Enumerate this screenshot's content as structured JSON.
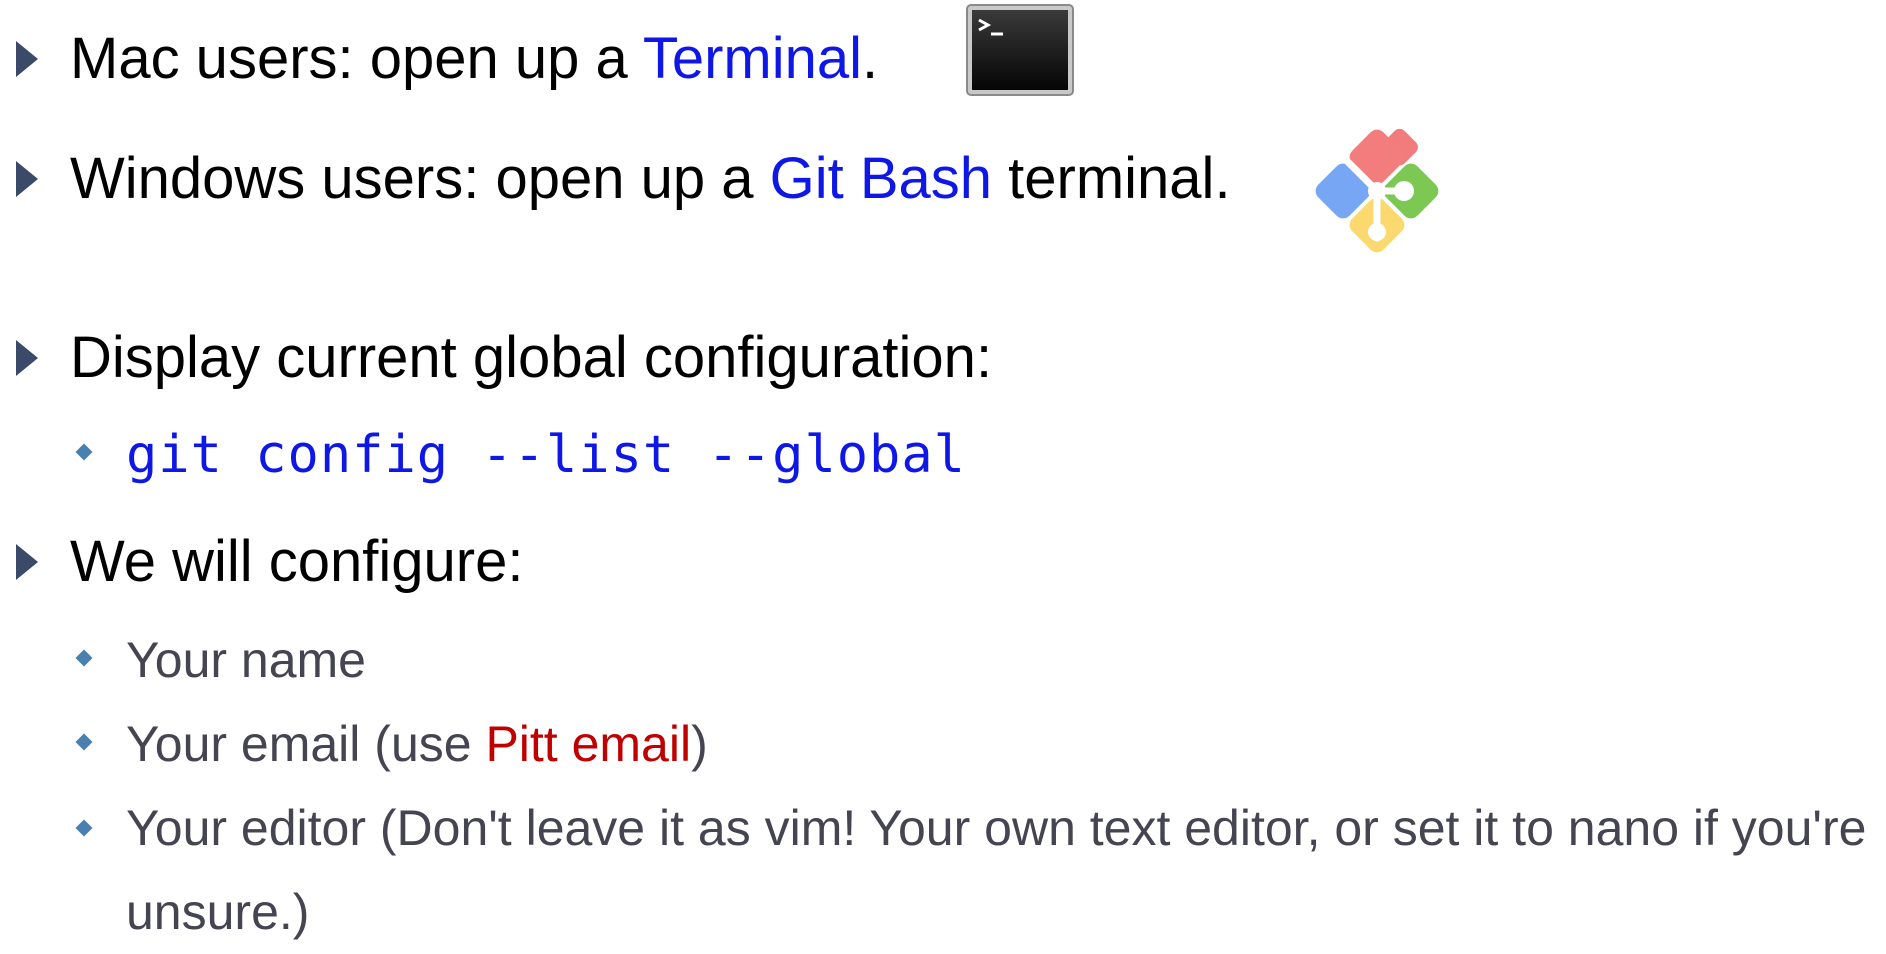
{
  "slide": {
    "b1": {
      "text": "Mac users: open up a ",
      "link": "Terminal",
      "end": "."
    },
    "b2": {
      "text": "Windows users: open up a ",
      "link": "Git Bash",
      "end": " terminal."
    },
    "b3": {
      "text": "Display current global configuration:"
    },
    "b3_sub": {
      "code": "git config --list --global"
    },
    "b4": {
      "text": "We will configure:"
    },
    "b4_sub": [
      {
        "text": "Your name"
      },
      {
        "text": "Your email (use ",
        "highlight": "Pitt email",
        "end": ")"
      },
      {
        "text": "Your editor (Don't leave it as vim! Your own text editor, or set it to nano if you're unsure.)"
      }
    ]
  },
  "icons": {
    "terminal": "terminal-icon",
    "git": "git-bash-icon"
  },
  "colors": {
    "link": "#0f17e6",
    "highlight": "#c00000",
    "bullet_arrow": "#3b4a68",
    "bullet_diamond": "#4a80b0",
    "sub_text": "#454552"
  }
}
